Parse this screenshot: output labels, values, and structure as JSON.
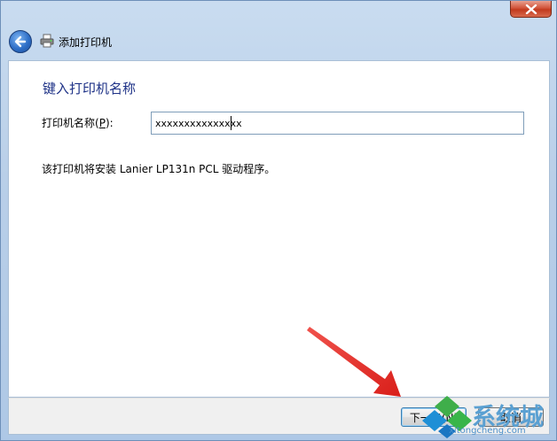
{
  "window": {
    "title": "添加打印机",
    "close_icon": "close-icon",
    "back_icon": "back-arrow-icon",
    "title_icon": "printer-icon"
  },
  "content": {
    "heading": "键入打印机名称",
    "field_label_prefix": "打印机名称(",
    "field_label_hotkey": "P",
    "field_label_suffix": "):",
    "printer_name_value": "xxxxxxxxxxxxxxx",
    "driver_message": "该打印机将安装 Lanier LP131n PCL 驱动程序。"
  },
  "footer": {
    "next_label": "下一步(N)",
    "cancel_label": "取消"
  },
  "watermark": {
    "text": "系统城",
    "url": "xitongcheng.com"
  },
  "colors": {
    "heading": "#1e3287",
    "arrow": "#e8322d",
    "close": "#c23a1e"
  }
}
